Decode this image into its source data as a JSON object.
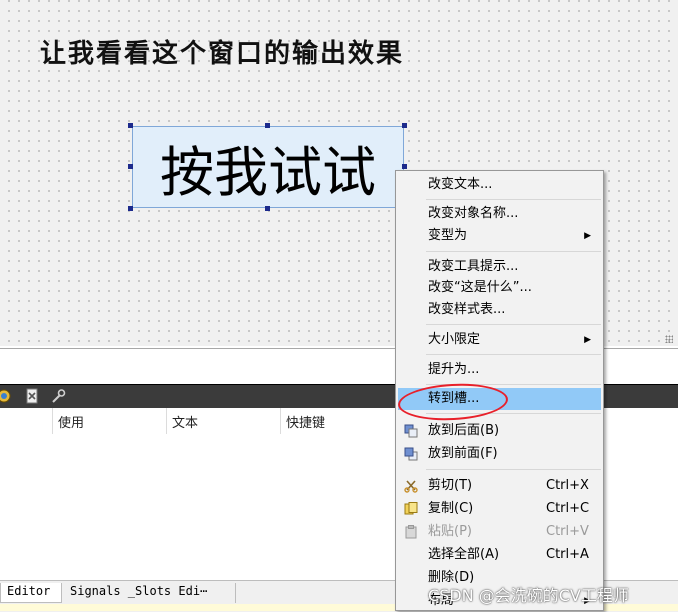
{
  "canvas": {
    "title_label": "让我看看这个窗口的输出效果",
    "push_button_text": "按我试试"
  },
  "action_editor": {
    "columns": [
      "使用",
      "文本",
      "快捷键"
    ],
    "toolbar_icons": [
      "new-action-icon",
      "delete-action-icon",
      "configure-icon"
    ]
  },
  "tabs": {
    "action_editor": "Editor",
    "signals_slots": "Signals _Slots Edi⋯"
  },
  "context_menu": {
    "items": [
      {
        "label": "改变文本...",
        "shortcut": "",
        "submenu": false
      },
      {
        "label": "改变对象名称...",
        "shortcut": "",
        "submenu": false
      },
      {
        "label": "变型为",
        "shortcut": "",
        "submenu": true
      },
      {
        "label": "改变工具提示...",
        "shortcut": "",
        "submenu": false
      },
      {
        "label": "改变“这是什么”...",
        "shortcut": "",
        "submenu": false
      },
      {
        "label": "改变样式表...",
        "shortcut": "",
        "submenu": false
      },
      {
        "label": "大小限定",
        "shortcut": "",
        "submenu": true
      },
      {
        "label": "提升为...",
        "shortcut": "",
        "submenu": false
      },
      {
        "label": "转到槽...",
        "shortcut": "",
        "submenu": false,
        "highlighted": true
      },
      {
        "label": "放到后面(B)",
        "shortcut": "",
        "submenu": false,
        "icon": "send-to-back-icon"
      },
      {
        "label": "放到前面(F)",
        "shortcut": "",
        "submenu": false,
        "icon": "bring-to-front-icon"
      },
      {
        "label": "剪切(T)",
        "shortcut": "Ctrl+X",
        "submenu": false,
        "icon": "scissors-icon"
      },
      {
        "label": "复制(C)",
        "shortcut": "Ctrl+C",
        "submenu": false,
        "icon": "copy-icon"
      },
      {
        "label": "粘贴(P)",
        "shortcut": "Ctrl+V",
        "submenu": false,
        "icon": "paste-icon",
        "disabled": true
      },
      {
        "label": "选择全部(A)",
        "shortcut": "Ctrl+A",
        "submenu": false
      },
      {
        "label": "删除(D)",
        "shortcut": "",
        "submenu": false
      },
      {
        "label": "布局",
        "shortcut": "",
        "submenu": true
      }
    ]
  },
  "watermark": "CSDN @会洗碗的CV工程师",
  "colors": {
    "highlight": "#91c9f7",
    "annotation_circle": "#e8202a",
    "button_fill": "#e1eefa",
    "selection_handle": "#1c2a8c"
  }
}
